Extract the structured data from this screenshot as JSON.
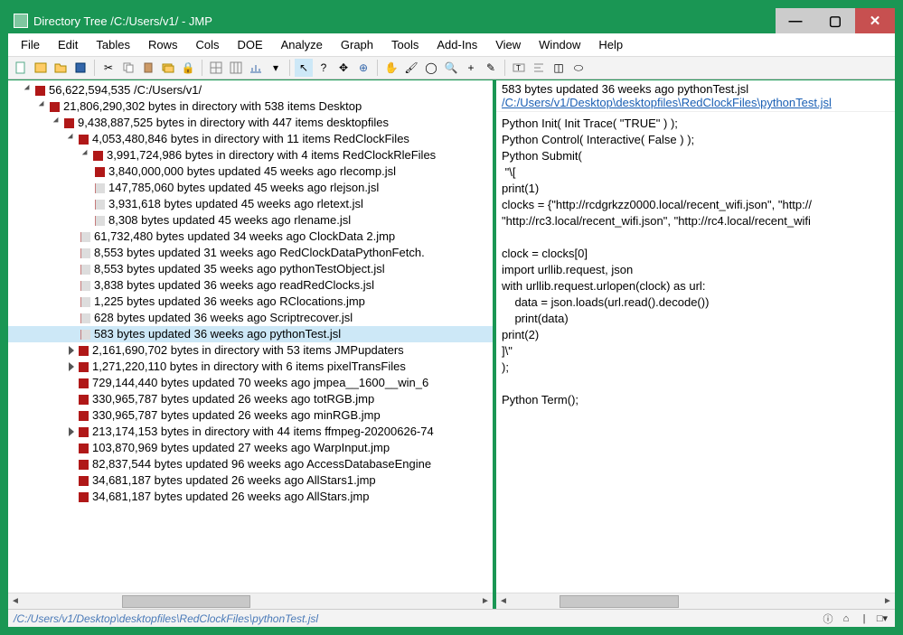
{
  "window": {
    "title": "Directory Tree /C:/Users/v1/ - JMP"
  },
  "menu": [
    "File",
    "Edit",
    "Tables",
    "Rows",
    "Cols",
    "DOE",
    "Analyze",
    "Graph",
    "Tools",
    "Add-Ins",
    "View",
    "Window",
    "Help"
  ],
  "tree": {
    "root": "56,622,594,535 /C:/Users/v1/",
    "desktop": "21,806,290,302 bytes in directory with 538 items Desktop",
    "desktopfiles": "9,438,887,525 bytes in directory with 447 items desktopfiles",
    "redclock": "4,053,480,846 bytes in directory with 11 items RedClockFiles",
    "rlefiles": "3,991,724,986 bytes in directory with 4 items RedClockRleFiles",
    "rlecomp": "3,840,000,000 bytes   updated 45 weeks ago   rlecomp.jsl",
    "rlejson": "147,785,060 bytes   updated 45 weeks ago   rlejson.jsl",
    "rletext": "3,931,618 bytes   updated 45 weeks ago   rletext.jsl",
    "rlename": "8,308 bytes   updated 45 weeks ago   rlename.jsl",
    "clockdata2": "61,732,480 bytes   updated 34 weeks ago   ClockData 2.jmp",
    "pyfetch": "8,553 bytes   updated 31 weeks ago   RedClockDataPythonFetch.",
    "pytestobj": "8,553 bytes   updated 35 weeks ago   pythonTestObject.jsl",
    "readred": "3,838 bytes   updated 36 weeks ago   readRedClocks.jsl",
    "rcloc": "1,225 bytes   updated 36 weeks ago   RClocations.jmp",
    "scriptrec": "628 bytes   updated 36 weeks ago   Scriptrecover.jsl",
    "pytest": "583 bytes   updated 36 weeks ago   pythonTest.jsl",
    "jmpupd": "2,161,690,702 bytes in directory with 53 items JMPupdaters",
    "pixtrans": "1,271,220,110 bytes in directory with 6 items pixelTransFiles",
    "jmpea": "729,144,440 bytes   updated 70 weeks ago   jmpea__1600__win_6",
    "totrgb": "330,965,787 bytes   updated 26 weeks ago   totRGB.jmp",
    "minrgb": "330,965,787 bytes   updated 26 weeks ago   minRGB.jmp",
    "ffmpeg": "213,174,153 bytes in directory with 44 items ffmpeg-20200626-74",
    "warp": "103,870,969 bytes   updated 27 weeks ago   WarpInput.jmp",
    "access": "82,837,544 bytes   updated 96 weeks ago   AccessDatabaseEngine",
    "allstars1": "34,681,187 bytes   updated 26 weeks ago   AllStars1.jmp",
    "allstars": "34,681,187 bytes   updated 26 weeks ago   AllStars.jmp"
  },
  "detail": {
    "meta": "583 bytes   updated 36 weeks ago   pythonTest.jsl",
    "link": "/C:/Users/v1/Desktop\\desktopfiles\\RedClockFiles\\pythonTest.jsl",
    "code": "Python Init( Init Trace( \"TRUE\" ) );\nPython Control( Interactive( False ) );\nPython Submit(\n \"\\[\nprint(1)\nclocks = {\"http://rcdgrkzz0000.local/recent_wifi.json\", \"http://\n\"http://rc3.local/recent_wifi.json\", \"http://rc4.local/recent_wifi\n\nclock = clocks[0]\nimport urllib.request, json\nwith urllib.request.urlopen(clock) as url:\n    data = json.loads(url.read().decode())\n    print(data)\nprint(2)\n]\\\"\n);\n\nPython Term();"
  },
  "status": {
    "path": "/C:/Users/v1/Desktop\\desktopfiles\\RedClockFiles\\pythonTest.jsl"
  }
}
